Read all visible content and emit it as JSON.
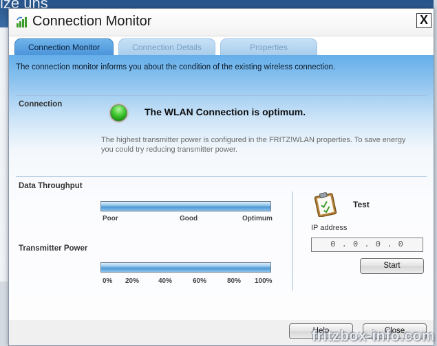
{
  "background": {
    "partial_text": "ize uns"
  },
  "window": {
    "title": "Connection Monitor",
    "close_label": "X"
  },
  "tabs": [
    {
      "label": "Connection Monitor",
      "active": true
    },
    {
      "label": "Connection Details",
      "active": false
    },
    {
      "label": "Properties",
      "active": false
    }
  ],
  "intro_text": "The connection monitor informs you about the condition of the existing wireless connection.",
  "connection": {
    "label": "Connection",
    "status_icon": "green-led-icon",
    "status_text": "The WLAN Connection is optimum.",
    "hint": "The highest transmitter power is configured in the FRITZ!WLAN properties. To save energy you could try reducing transmitter power."
  },
  "throughput": {
    "label": "Data Throughput",
    "level": 1.0,
    "ticks": [
      "Poor",
      "Good",
      "Optimum"
    ]
  },
  "transmitter": {
    "label": "Transmitter Power",
    "level": 1.0,
    "ticks": [
      "0%",
      "20%",
      "40%",
      "60%",
      "80%",
      "100%"
    ]
  },
  "test": {
    "icon": "clipboard-check-icon",
    "label": "Test",
    "ip_label": "IP address",
    "ip_value": "0 . 0 . 0 . 0",
    "start_label": "Start"
  },
  "footer": {
    "help_label": "Help",
    "close_label": "Close"
  },
  "watermark": "fritzbox-info.com",
  "colors": {
    "tab_active": "#4b95d9",
    "panel_top": "#64aeea",
    "led": "#4fd13d"
  }
}
